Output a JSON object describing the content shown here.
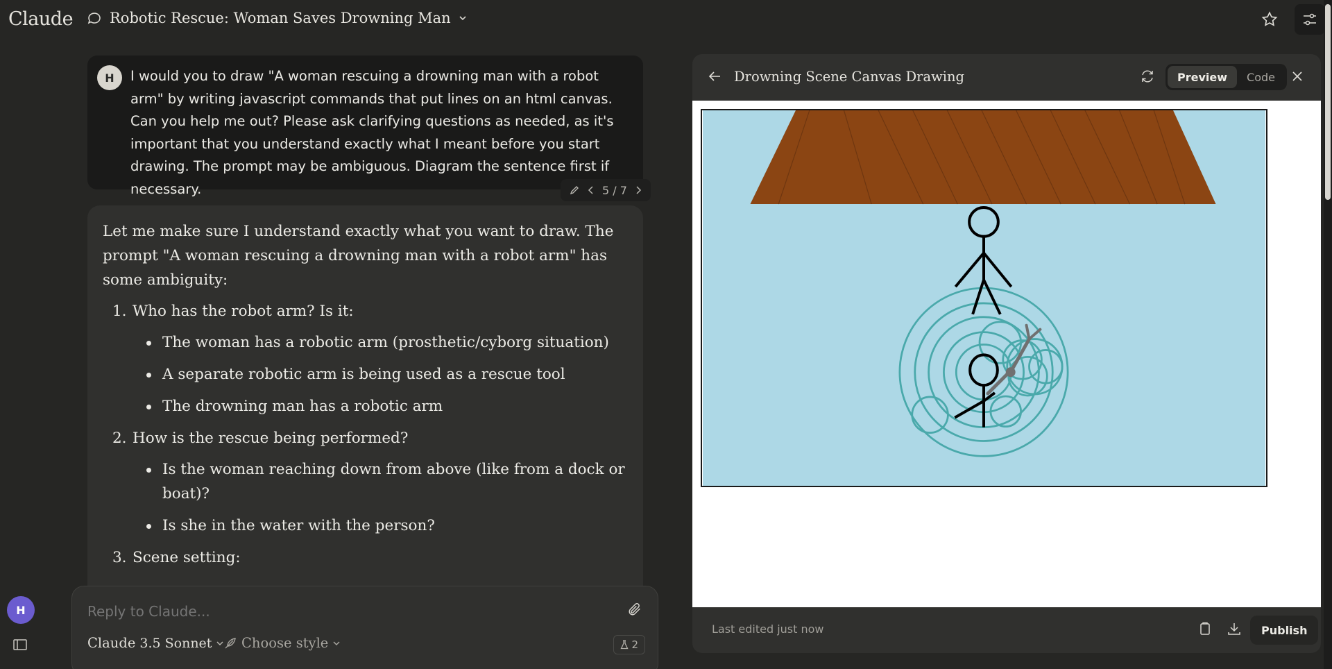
{
  "app": {
    "logo": "Claude"
  },
  "conversation": {
    "title": "Robotic Rescue: Woman Saves Drowning Man"
  },
  "user_message": {
    "avatar": "H",
    "text": "I would you to draw \"A woman rescuing a drowning man with a robot arm\" by writing javascript commands that put lines on an html canvas. Can you help me out? Please ask clarifying questions as needed, as it's important that you understand exactly what I meant before you start drawing. The prompt may be ambiguous. Diagram the sentence first if necessary.",
    "version": "5 / 7"
  },
  "assistant_message": {
    "intro": "Let me make sure I understand exactly what you want to draw. The prompt \"A woman rescuing a drowning man with a robot arm\" has some ambiguity:",
    "questions": [
      {
        "num": "1.",
        "text": "Who has the robot arm? Is it:",
        "options": [
          "The woman has a robotic arm (prosthetic/cyborg situation)",
          "A separate robotic arm is being used as a rescue tool",
          "The drowning man has a robotic arm"
        ]
      },
      {
        "num": "2.",
        "text": "How is the rescue being performed?",
        "options": [
          "Is the woman reaching down from above (like from a dock or boat)?",
          "Is she in the water with the person?"
        ]
      },
      {
        "num": "3.",
        "text": "Scene setting:",
        "options": []
      }
    ]
  },
  "composer": {
    "placeholder": "Reply to Claude...",
    "model_name": "Claude",
    "model_version": "3.5 Sonnet",
    "style_label": "Choose style",
    "count": "2"
  },
  "sidebar": {
    "user_initial": "H"
  },
  "artifact": {
    "title": "Drowning Scene Canvas Drawing",
    "tab_preview": "Preview",
    "tab_code": "Code",
    "last_edited": "Last edited just now",
    "publish_label": "Publish"
  },
  "colors": {
    "background": "#262624",
    "sky": "#add8e6",
    "dock": "#8b4513",
    "ripple": "#4aa9ab",
    "robot_arm": "#707070",
    "avatar_accent": "#6b5ccf"
  }
}
